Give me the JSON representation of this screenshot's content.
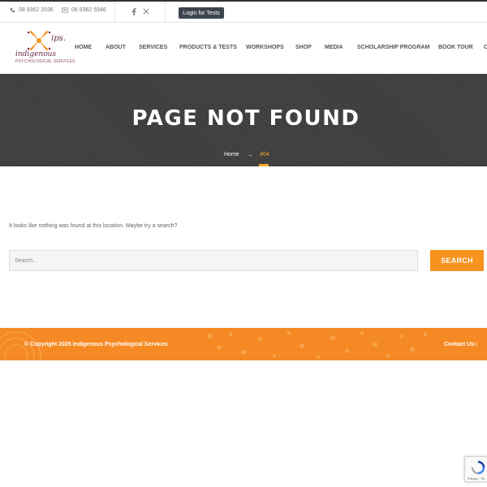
{
  "topbar": {
    "phone": "08 9362 2036",
    "fax": "08 9362 5546",
    "login_label": "Login for Tests",
    "social": [
      "facebook-icon",
      "x-icon"
    ]
  },
  "logo": {
    "mark": "ips.",
    "script": "indigenous",
    "subtitle": "PSYCHOLOGICAL SERVICES"
  },
  "nav": {
    "items": [
      "HOME",
      "ABOUT",
      "SERVICES",
      "PRODUCTS & TESTS",
      "WORKSHOPS",
      "SHOP",
      "MEDIA",
      "SCHOLARSHIP PROGRAM",
      "BOOK TOUR",
      "C"
    ]
  },
  "hero": {
    "title": "PAGE NOT FOUND",
    "breadcrumb_home": "Home",
    "breadcrumb_current": "404"
  },
  "main": {
    "message": "It looks like nothing was found at this location. Maybe try a search?",
    "search_placeholder": "Search...",
    "search_button": "SEARCH"
  },
  "footer": {
    "copyright": "© Copyright 2025 Indigenous Psychological Services",
    "contact": "Contact Us"
  },
  "recaptcha": {
    "links": "Privacy - Te"
  },
  "colors": {
    "accent": "#f7931e",
    "hero_bg": "#3f3f3f",
    "login_bg": "#3d4450",
    "breadcrumb_active": "#f6a830"
  }
}
